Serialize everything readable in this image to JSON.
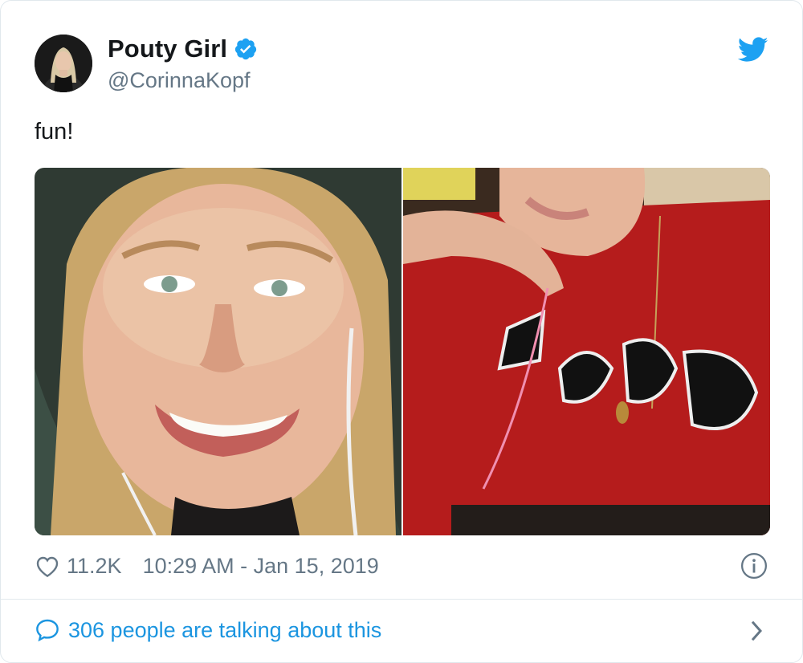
{
  "author": {
    "display_name": "Pouty Girl",
    "handle": "@CorinnaKopf",
    "verified": true
  },
  "tweet": {
    "text": "fun!",
    "like_count": "11.2K",
    "timestamp": "10:29 AM - Jan 15, 2019"
  },
  "conversation": {
    "label": "306 people are talking about this"
  },
  "media": [
    {
      "description_icon": "photo-left"
    },
    {
      "description_icon": "photo-right"
    }
  ],
  "icons": {
    "brand": "twitter-bird-icon",
    "verified": "verified-badge-icon",
    "like": "heart-icon",
    "info": "info-icon",
    "reply": "speech-bubble-icon",
    "more": "chevron-right-icon"
  },
  "colors": {
    "brand_blue": "#1da1f2",
    "link_blue": "#1b95e0",
    "muted": "#657786",
    "text": "#14171a",
    "border": "#e1e8ed"
  }
}
